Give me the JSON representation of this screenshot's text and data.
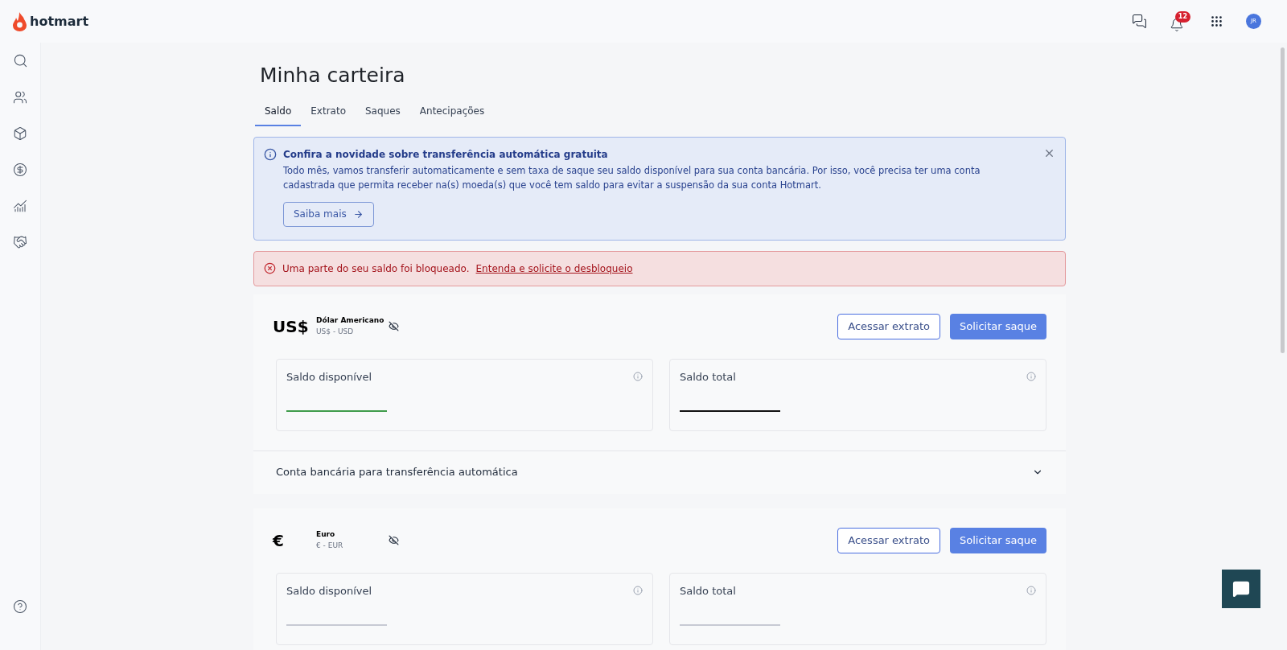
{
  "header": {
    "logo": "hotmart",
    "notifications": "12",
    "avatar": "JR"
  },
  "sidebar": {
    "items": [
      {
        "kind": "search"
      },
      {
        "kind": "users"
      },
      {
        "kind": "box"
      },
      {
        "kind": "dollar"
      },
      {
        "kind": "chart"
      },
      {
        "kind": "handshake"
      }
    ],
    "help": {
      "kind": "help"
    }
  },
  "page": {
    "title": "Minha carteira"
  },
  "tabs": [
    {
      "label": "Saldo",
      "selected": true
    },
    {
      "label": "Extrato",
      "selected": false
    },
    {
      "label": "Saques",
      "selected": false
    },
    {
      "label": "Antecipações",
      "selected": false
    }
  ],
  "info_alert": {
    "title": "Confira a novidade sobre transferência automática gratuita",
    "text": "Todo mês, vamos transferir automaticamente e sem taxa de saque seu saldo disponível para sua conta bancária. Por isso, você precisa ter uma conta cadastrada que permita receber na(s) moeda(s) que você tem saldo para evitar a suspensão da sua conta Hotmart.",
    "button": "Saiba mais"
  },
  "error_alert": {
    "text": "Uma parte do seu saldo foi bloqueado.",
    "link": "Entenda e solicite o desbloqueio"
  },
  "currencies": [
    {
      "symbol": "US$",
      "name": "Dólar Americano",
      "code": "US$ - USD",
      "secondary_button": "Acessar extrato",
      "primary_button": "Solicitar saque",
      "balances": [
        {
          "label": "Saldo disponível",
          "color": "#3f9c4a"
        },
        {
          "label": "Saldo total",
          "color": "#111111"
        }
      ],
      "bank_account": {
        "label": "Conta bancária para transferência automática",
        "expanded": false
      }
    },
    {
      "symbol": "€",
      "name": "Euro",
      "code": "€ - EUR",
      "secondary_button": "Acessar extrato",
      "primary_button": "Solicitar saque",
      "balances": [
        {
          "label": "Saldo disponível",
          "color": "#c7cad3"
        },
        {
          "label": "Saldo total",
          "color": "#c7cad3"
        }
      ]
    }
  ]
}
